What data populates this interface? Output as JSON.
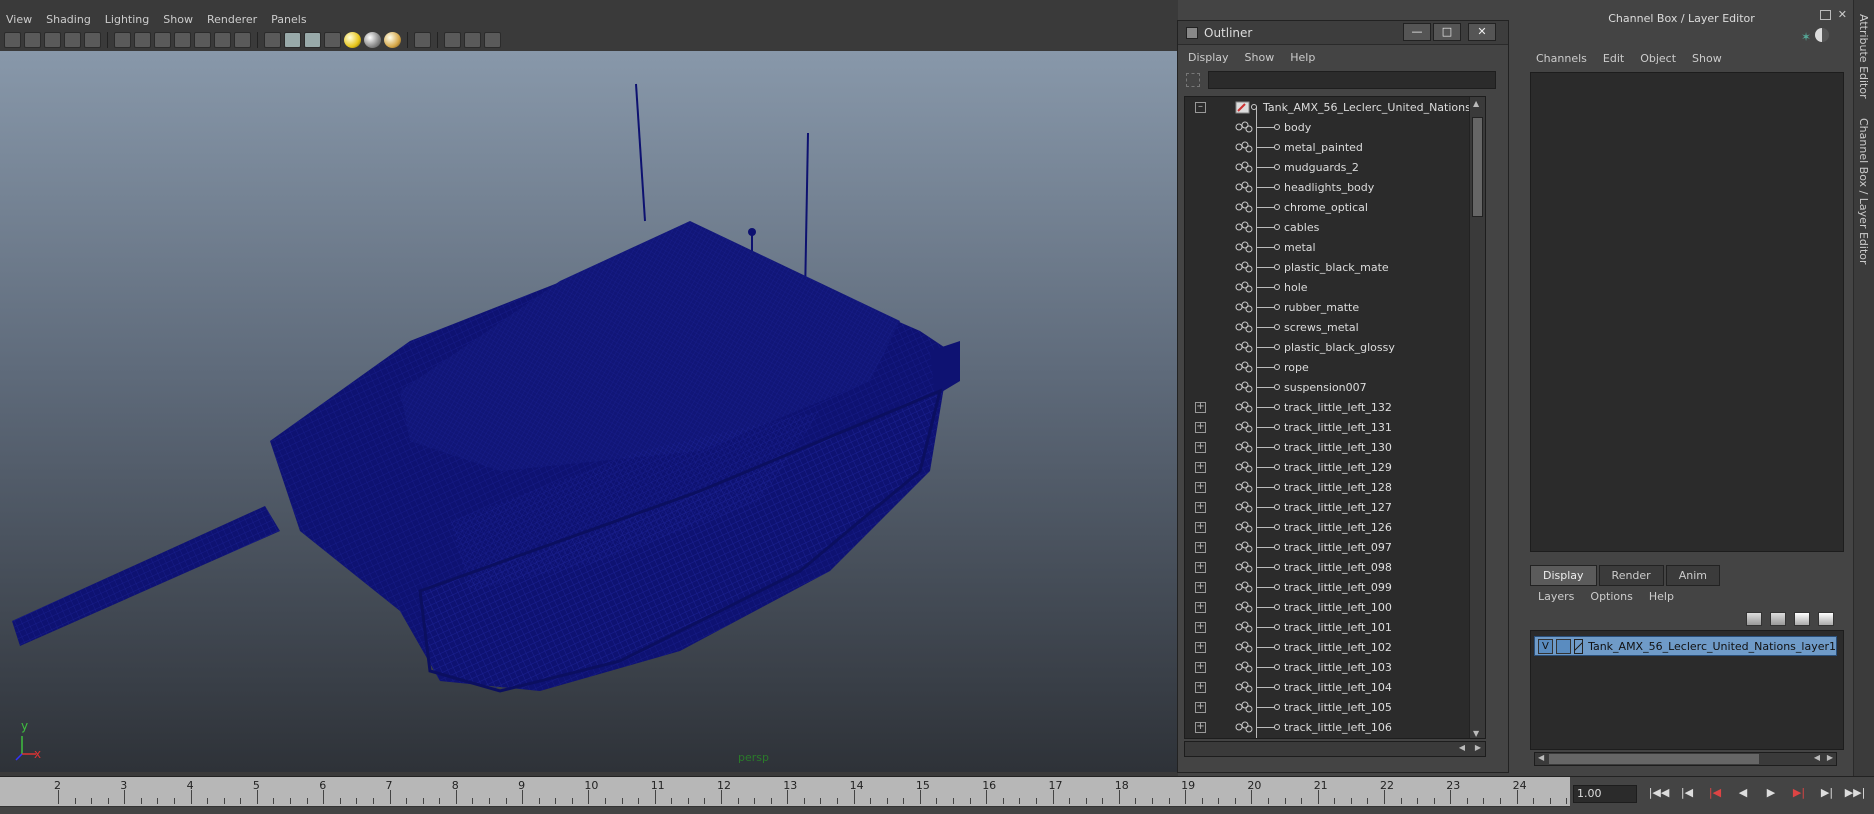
{
  "viewport": {
    "menu": [
      "View",
      "Shading",
      "Lighting",
      "Show",
      "Renderer",
      "Panels"
    ],
    "camera_label": "persp",
    "axis_y": "y",
    "axis_x": "x"
  },
  "outliner": {
    "title": "Outliner",
    "menu": [
      "Display",
      "Show",
      "Help"
    ],
    "search_value": "",
    "root": "Tank_AMX_56_Leclerc_United_Nations",
    "children": [
      {
        "label": "body",
        "expandable": false
      },
      {
        "label": "metal_painted",
        "expandable": false
      },
      {
        "label": "mudguards_2",
        "expandable": false
      },
      {
        "label": "headlights_body",
        "expandable": false
      },
      {
        "label": "chrome_optical",
        "expandable": false
      },
      {
        "label": "cables",
        "expandable": false
      },
      {
        "label": "metal",
        "expandable": false
      },
      {
        "label": "plastic_black_mate",
        "expandable": false
      },
      {
        "label": "hole",
        "expandable": false
      },
      {
        "label": "rubber_matte",
        "expandable": false
      },
      {
        "label": "screws_metal",
        "expandable": false
      },
      {
        "label": "plastic_black_glossy",
        "expandable": false
      },
      {
        "label": "rope",
        "expandable": false
      },
      {
        "label": "suspension007",
        "expandable": false
      },
      {
        "label": "track_little_left_132",
        "expandable": true
      },
      {
        "label": "track_little_left_131",
        "expandable": true
      },
      {
        "label": "track_little_left_130",
        "expandable": true
      },
      {
        "label": "track_little_left_129",
        "expandable": true
      },
      {
        "label": "track_little_left_128",
        "expandable": true
      },
      {
        "label": "track_little_left_127",
        "expandable": true
      },
      {
        "label": "track_little_left_126",
        "expandable": true
      },
      {
        "label": "track_little_left_097",
        "expandable": true
      },
      {
        "label": "track_little_left_098",
        "expandable": true
      },
      {
        "label": "track_little_left_099",
        "expandable": true
      },
      {
        "label": "track_little_left_100",
        "expandable": true
      },
      {
        "label": "track_little_left_101",
        "expandable": true
      },
      {
        "label": "track_little_left_102",
        "expandable": true
      },
      {
        "label": "track_little_left_103",
        "expandable": true
      },
      {
        "label": "track_little_left_104",
        "expandable": true
      },
      {
        "label": "track_little_left_105",
        "expandable": true
      },
      {
        "label": "track_little_left_106",
        "expandable": true
      }
    ]
  },
  "channelbox": {
    "title": "Channel Box / Layer Editor",
    "menu": [
      "Channels",
      "Edit",
      "Object",
      "Show"
    ],
    "tabs": [
      "Display",
      "Render",
      "Anim"
    ],
    "active_tab": "Display",
    "layer_menu": [
      "Layers",
      "Options",
      "Help"
    ],
    "layer": {
      "visible_flag": "V",
      "name": "Tank_AMX_56_Leclerc_United_Nations_layer1"
    },
    "side_tabs": [
      "Attribute Editor",
      "Channel Box / Layer Editor"
    ]
  },
  "timeline": {
    "frames": [
      "2",
      "3",
      "4",
      "5",
      "6",
      "7",
      "8",
      "9",
      "10",
      "11",
      "12",
      "13",
      "14",
      "15",
      "16",
      "17",
      "18",
      "19",
      "20",
      "21",
      "22",
      "23",
      "24"
    ],
    "current_frame": "1.00"
  },
  "colors": {
    "wireframe": "#0d1170",
    "layer_highlight": "#6f9bc8",
    "camera_label": "#2a7a2a"
  }
}
